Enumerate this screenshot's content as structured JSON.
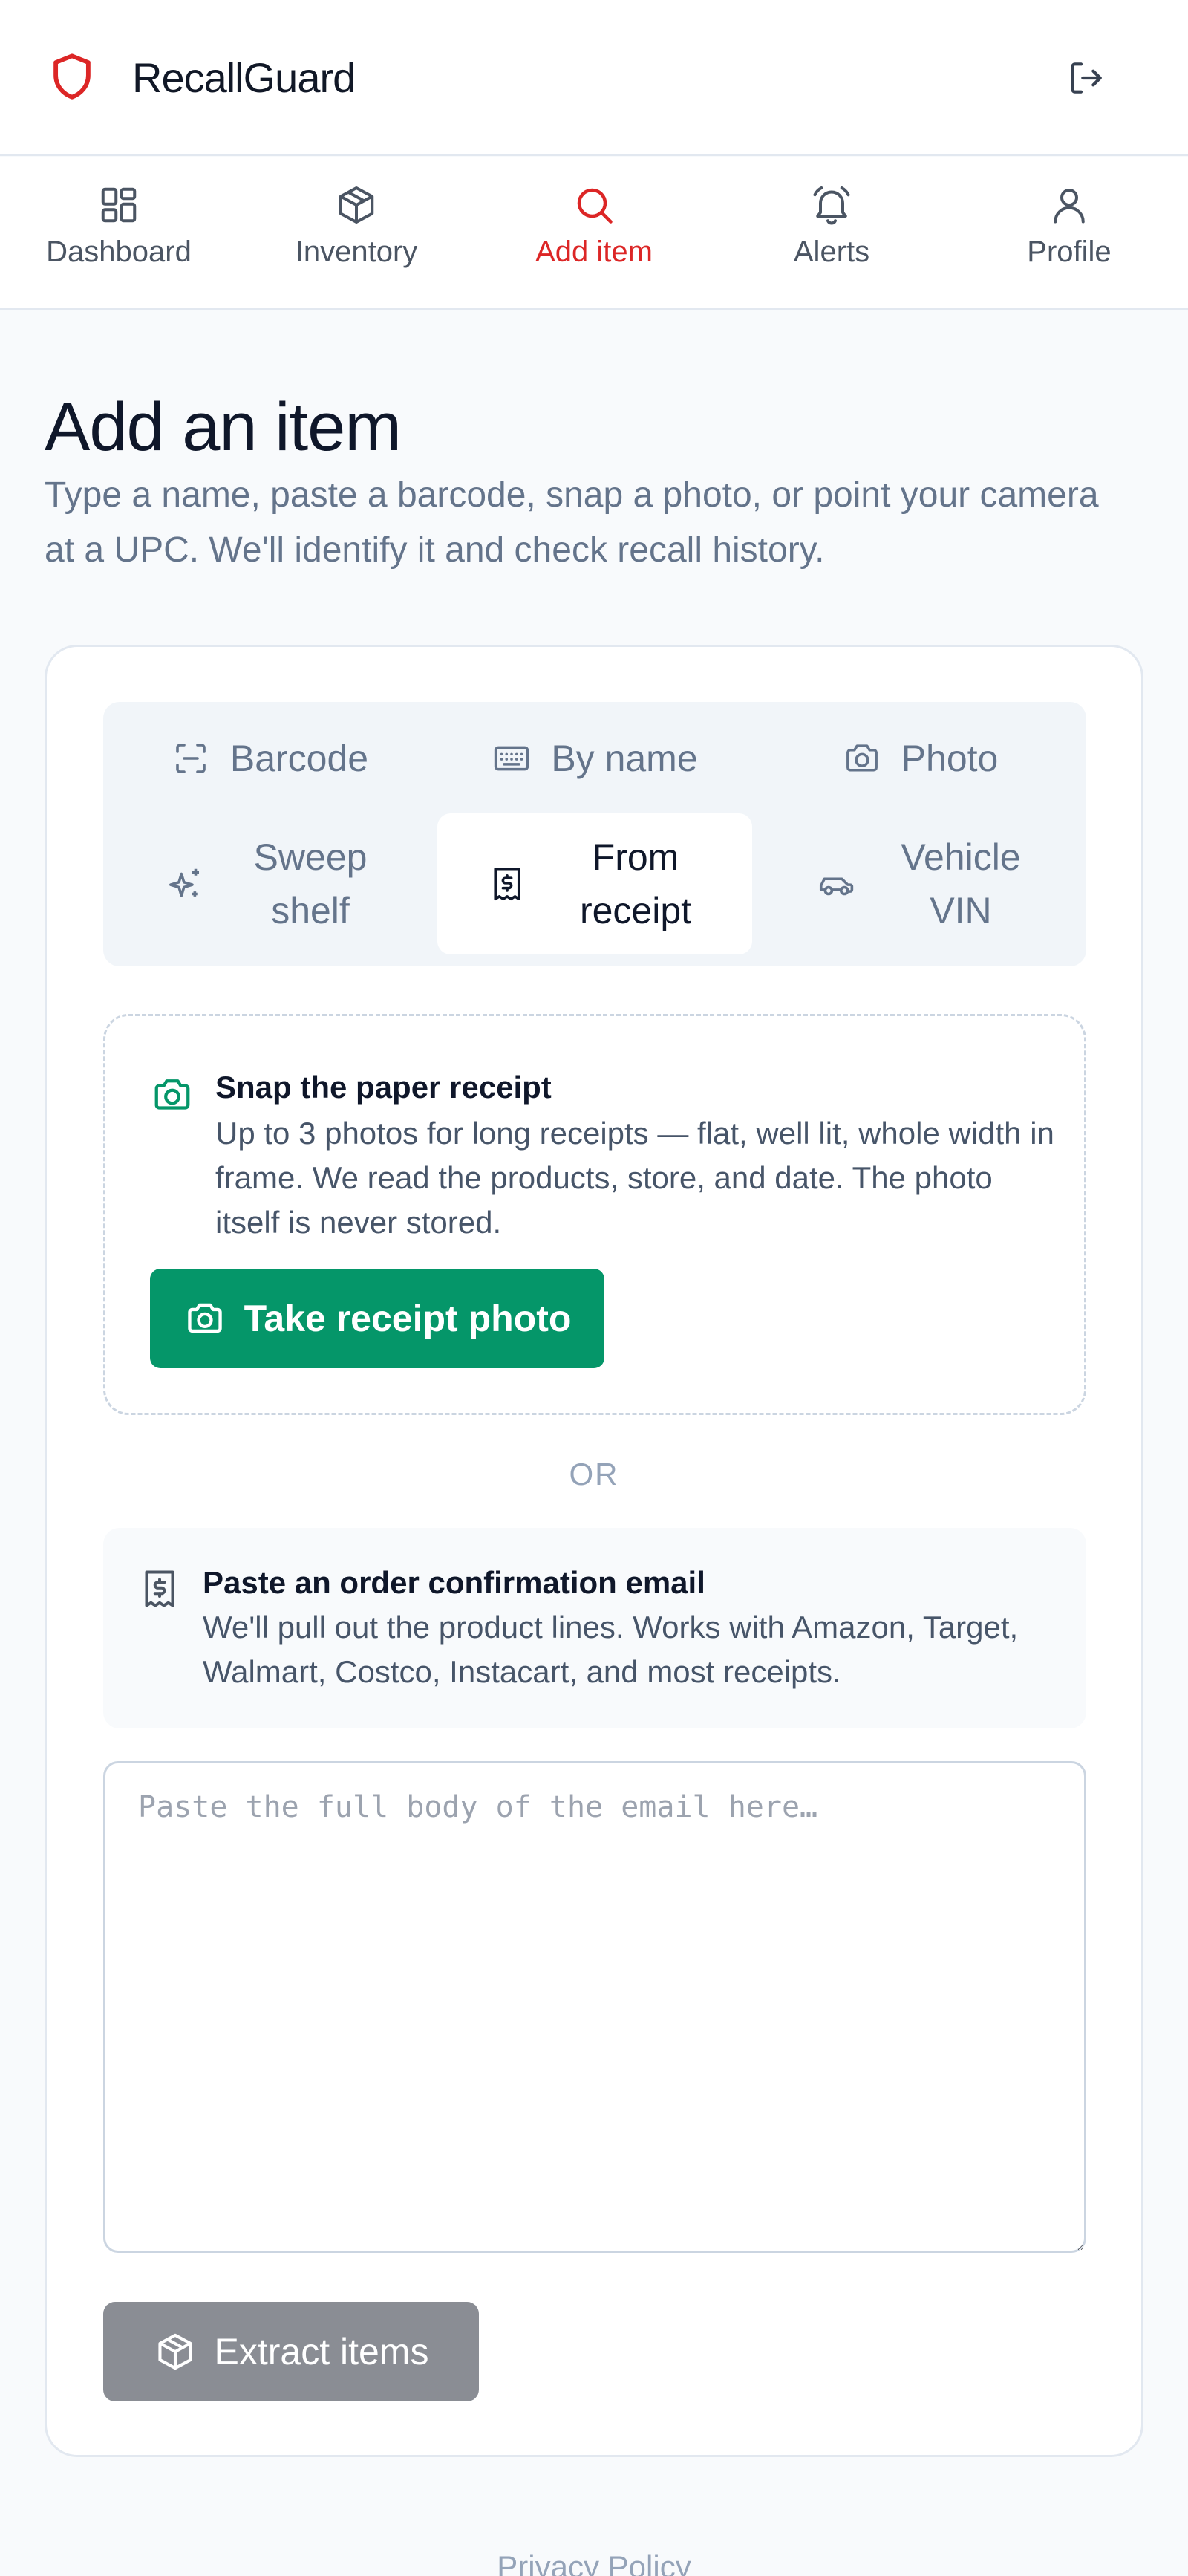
{
  "app": {
    "title": "RecallGuard",
    "accent_color": "#dc2626",
    "logo_icon": "shield-icon",
    "logout_icon": "logout-icon"
  },
  "nav": {
    "items": [
      {
        "label": "Dashboard",
        "icon": "grid-icon",
        "active": false
      },
      {
        "label": "Inventory",
        "icon": "box-icon",
        "active": false
      },
      {
        "label": "Add item",
        "icon": "search-icon",
        "active": true
      },
      {
        "label": "Alerts",
        "icon": "bell-icon",
        "active": false
      },
      {
        "label": "Profile",
        "icon": "user-icon",
        "active": false
      }
    ]
  },
  "page": {
    "title": "Add an item",
    "subtitle": "Type a name, paste a barcode, snap a photo, or point your camera at a UPC. We'll identify it and check recall history."
  },
  "tabs": {
    "items": [
      {
        "label": "Barcode",
        "icon": "barcode-scan-icon",
        "active": false
      },
      {
        "label": "By name",
        "icon": "keyboard-icon",
        "active": false
      },
      {
        "label": "Photo",
        "icon": "camera-icon",
        "active": false
      },
      {
        "label": "Sweep shelf",
        "icon": "sparkles-icon",
        "active": false
      },
      {
        "label": "From receipt",
        "icon": "receipt-icon",
        "active": true
      },
      {
        "label": "Vehicle VIN",
        "icon": "car-icon",
        "active": false
      }
    ]
  },
  "receipt_photo": {
    "title": "Snap the paper receipt",
    "description": "Up to 3 photos for long receipts — flat, well lit, whole width in frame. We read the products, store, and date. The photo itself is never stored.",
    "button_label": "Take receipt photo",
    "button_color": "#059669",
    "icon": "camera-icon"
  },
  "divider": {
    "label": "OR"
  },
  "email_import": {
    "title": "Paste an order confirmation email",
    "description": "We'll pull out the product lines. Works with Amazon, Target, Walmart, Costco, Instacart, and most receipts.",
    "icon": "receipt-icon",
    "textarea_value": "",
    "textarea_placeholder": "Paste the full body of the email here…",
    "button_label": "Extract items",
    "button_icon": "box-icon"
  },
  "footer": {
    "link_label": "Privacy Policy"
  }
}
